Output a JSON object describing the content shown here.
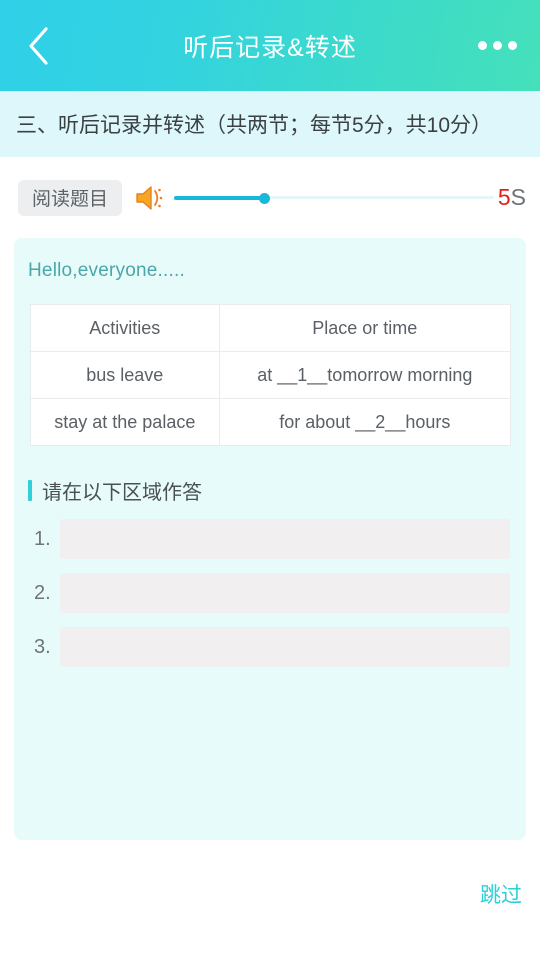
{
  "navbar": {
    "title": "听后记录&转述",
    "back_icon": "chevron-left-icon",
    "more_icon": "ellipsis-icon"
  },
  "section_banner": {
    "text": "三、听后记录并转述（共两节；每节5分，共10分）"
  },
  "audio_control": {
    "read_button_label": "阅读题目",
    "speaker_icon": "speaker-volume-icon",
    "progress_percent": 28,
    "timer_value": "5",
    "timer_unit": "S",
    "timer_color": "#e02020",
    "accent_color": "#17b8dc"
  },
  "content": {
    "intro_text": "Hello,everyone.....",
    "table": {
      "headers": [
        "Activities",
        "Place or time"
      ],
      "rows": [
        [
          "bus leave",
          "at __1__tomorrow morning"
        ],
        [
          "stay at the palace",
          "for about __2__hours"
        ]
      ]
    },
    "answer_section": {
      "title": "请在以下区域作答",
      "rows": [
        {
          "number": "1.",
          "value": "",
          "placeholder": ""
        },
        {
          "number": "2.",
          "value": "",
          "placeholder": ""
        },
        {
          "number": "3.",
          "value": "",
          "placeholder": ""
        }
      ]
    }
  },
  "footer": {
    "skip_label": "跳过"
  }
}
